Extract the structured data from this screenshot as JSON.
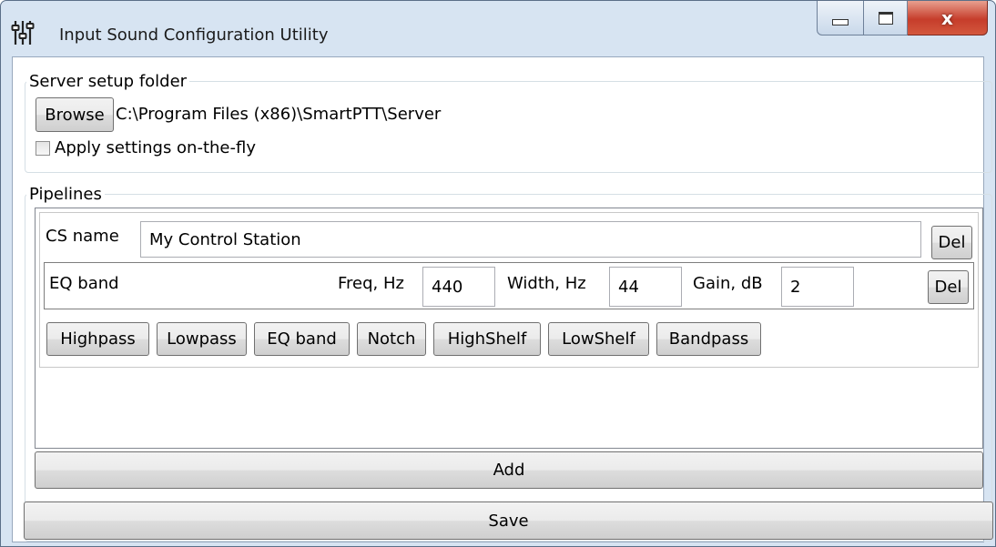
{
  "window": {
    "title": "Input Sound Configuration Utility",
    "icon": "equalizer-sliders-icon",
    "close_glyph": "x"
  },
  "server_setup": {
    "group_label": "Server setup folder",
    "browse_label": "Browse",
    "folder_path": "C:\\Program Files (x86)\\SmartPTT\\Server",
    "apply_on_the_fly_label": "Apply settings on-the-fly",
    "apply_on_the_fly_checked": false
  },
  "pipelines": {
    "group_label": "Pipelines",
    "cs_name_label": "CS name",
    "cs_name_value": "My Control Station",
    "del_label": "Del",
    "band": {
      "type_label": "EQ band",
      "freq_label": "Freq, Hz",
      "freq_value": "440",
      "width_label": "Width, Hz",
      "width_value": "44",
      "gain_label": "Gain, dB",
      "gain_value": "2",
      "del_label": "Del"
    },
    "filter_buttons": [
      "Highpass",
      "Lowpass",
      "EQ band",
      "Notch",
      "HighShelf",
      "LowShelf",
      "Bandpass"
    ],
    "add_label": "Add"
  },
  "save_label": "Save"
}
